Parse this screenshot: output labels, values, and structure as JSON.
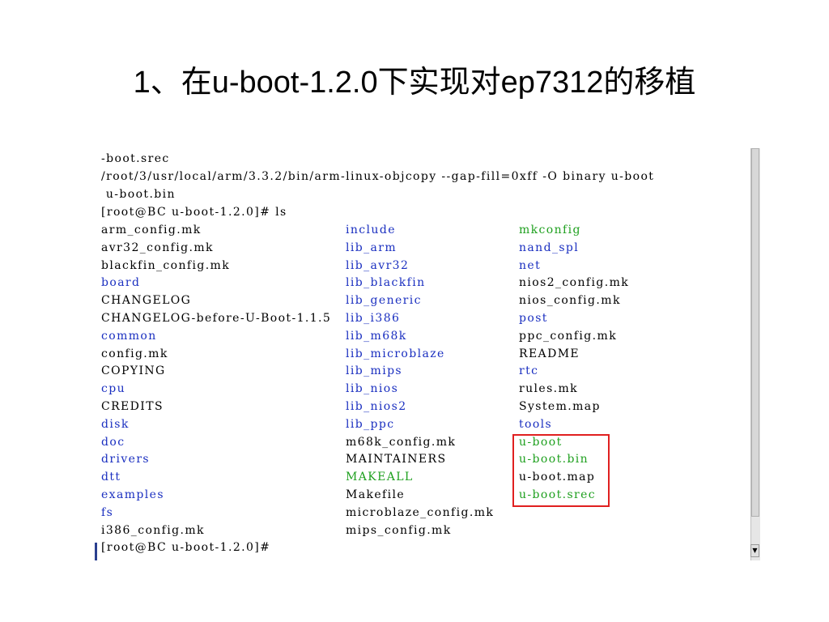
{
  "slide": {
    "title": "1、在u-boot-1.2.0下实现对ep7312的移植"
  },
  "terminal": {
    "cut_text": ". . . , . .",
    "lines": [
      "-boot.srec",
      "/root/3/usr/local/arm/3.3.2/bin/arm-linux-objcopy --gap-fill=0xff -O binary u-boot",
      " u-boot.bin",
      "[root@BC u-boot-1.2.0]# ls"
    ],
    "listing": [
      [
        {
          "text": "arm_config.mk",
          "color": "black"
        },
        {
          "text": "include",
          "color": "blue"
        },
        {
          "text": "mkconfig",
          "color": "green"
        }
      ],
      [
        {
          "text": "avr32_config.mk",
          "color": "black"
        },
        {
          "text": "lib_arm",
          "color": "blue"
        },
        {
          "text": "nand_spl",
          "color": "blue"
        }
      ],
      [
        {
          "text": "blackfin_config.mk",
          "color": "black"
        },
        {
          "text": "lib_avr32",
          "color": "blue"
        },
        {
          "text": "net",
          "color": "blue"
        }
      ],
      [
        {
          "text": "board",
          "color": "blue"
        },
        {
          "text": "lib_blackfin",
          "color": "blue"
        },
        {
          "text": "nios2_config.mk",
          "color": "black"
        }
      ],
      [
        {
          "text": "CHANGELOG",
          "color": "black"
        },
        {
          "text": "lib_generic",
          "color": "blue"
        },
        {
          "text": "nios_config.mk",
          "color": "black"
        }
      ],
      [
        {
          "text": "CHANGELOG-before-U-Boot-1.1.5",
          "color": "black"
        },
        {
          "text": "lib_i386",
          "color": "blue"
        },
        {
          "text": "post",
          "color": "blue"
        }
      ],
      [
        {
          "text": "common",
          "color": "blue"
        },
        {
          "text": "lib_m68k",
          "color": "blue"
        },
        {
          "text": "ppc_config.mk",
          "color": "black"
        }
      ],
      [
        {
          "text": "config.mk",
          "color": "black"
        },
        {
          "text": "lib_microblaze",
          "color": "blue"
        },
        {
          "text": "README",
          "color": "black"
        }
      ],
      [
        {
          "text": "COPYING",
          "color": "black"
        },
        {
          "text": "lib_mips",
          "color": "blue"
        },
        {
          "text": "rtc",
          "color": "blue"
        }
      ],
      [
        {
          "text": "cpu",
          "color": "blue"
        },
        {
          "text": "lib_nios",
          "color": "blue"
        },
        {
          "text": "rules.mk",
          "color": "black"
        }
      ],
      [
        {
          "text": "CREDITS",
          "color": "black"
        },
        {
          "text": "lib_nios2",
          "color": "blue"
        },
        {
          "text": "System.map",
          "color": "black"
        }
      ],
      [
        {
          "text": "disk",
          "color": "blue"
        },
        {
          "text": "lib_ppc",
          "color": "blue"
        },
        {
          "text": "tools",
          "color": "blue"
        }
      ],
      [
        {
          "text": "doc",
          "color": "blue"
        },
        {
          "text": "m68k_config.mk",
          "color": "black"
        },
        {
          "text": "u-boot",
          "color": "green"
        }
      ],
      [
        {
          "text": "drivers",
          "color": "blue"
        },
        {
          "text": "MAINTAINERS",
          "color": "black"
        },
        {
          "text": "u-boot.bin",
          "color": "green"
        }
      ],
      [
        {
          "text": "dtt",
          "color": "blue"
        },
        {
          "text": "MAKEALL",
          "color": "green"
        },
        {
          "text": "u-boot.map",
          "color": "black"
        }
      ],
      [
        {
          "text": "examples",
          "color": "blue"
        },
        {
          "text": "Makefile",
          "color": "black"
        },
        {
          "text": "u-boot.srec",
          "color": "green"
        }
      ],
      [
        {
          "text": "fs",
          "color": "blue"
        },
        {
          "text": "microblaze_config.mk",
          "color": "black"
        },
        {
          "text": "",
          "color": "black"
        }
      ],
      [
        {
          "text": "i386_config.mk",
          "color": "black"
        },
        {
          "text": "mips_config.mk",
          "color": "black"
        },
        {
          "text": "",
          "color": "black"
        }
      ]
    ],
    "prompt": "[root@BC u-boot-1.2.0]#"
  },
  "colors": {
    "black": "#000000",
    "blue": "#1a2fc0",
    "green": "#1fa01f",
    "highlight": "#e02020"
  }
}
